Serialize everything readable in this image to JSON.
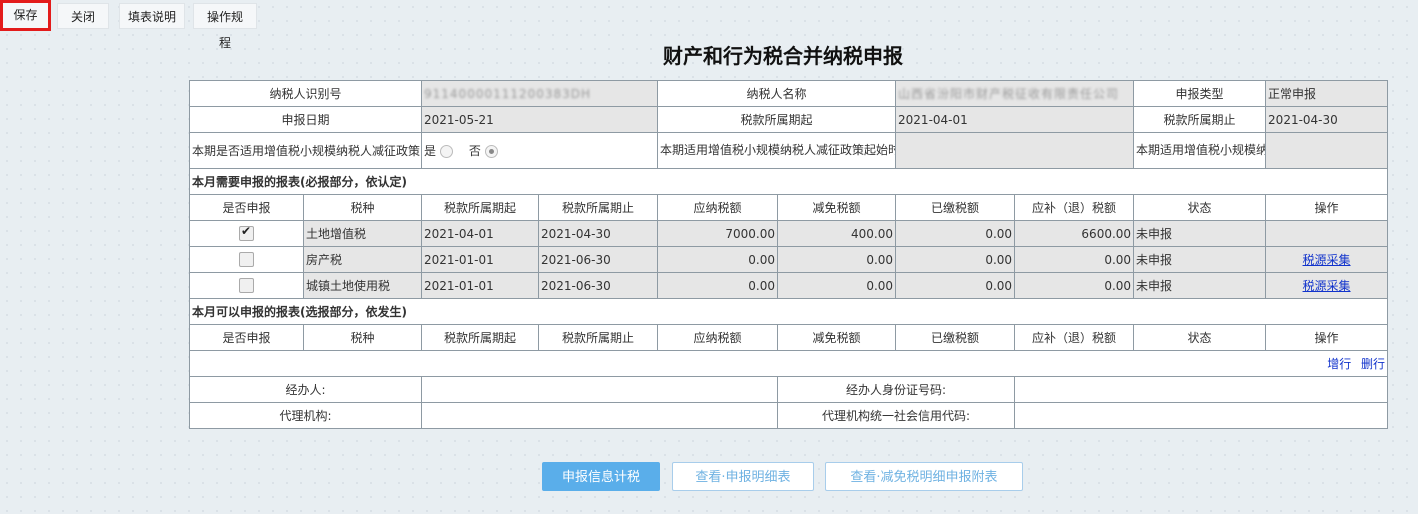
{
  "toolbar": {
    "save": "保存",
    "close": "关闭",
    "fill_help": "填表说明",
    "operation_rules": "操作规程"
  },
  "title": "财产和行为税合并纳税申报",
  "info": {
    "taxpayer_id_label": "纳税人识别号",
    "taxpayer_id_value": "91140000111200383DH",
    "taxpayer_name_label": "纳税人名称",
    "taxpayer_name_value": "山西省汾阳市财产税征收有限责任公司",
    "declare_type_label": "申报类型",
    "declare_type_value": "正常申报",
    "declare_date_label": "申报日期",
    "declare_date_value": "2021-05-21",
    "period_start_label": "税款所属期起",
    "period_start_value": "2021-04-01",
    "period_end_label": "税款所属期止",
    "period_end_value": "2021-04-30",
    "small_policy_label": "本期是否适用增值税小规模纳税人减征政策",
    "yes_label": "是",
    "no_label": "否",
    "policy_start_label": "本期适用增值税小规模纳税人减征政策起始时间",
    "policy_end_label": "本期适用增值税小规模纳税人减征政策终止时间"
  },
  "required_section": "本月需要申报的报表(必报部分，依认定)",
  "optional_section": "本月可以申报的报表(选报部分，依发生)",
  "columns": [
    "是否申报",
    "税种",
    "税款所属期起",
    "税款所属期止",
    "应纳税额",
    "减免税额",
    "已缴税额",
    "应补（退）税额",
    "状态",
    "操作"
  ],
  "rows": [
    {
      "checked": true,
      "tax": "土地增值税",
      "start": "2021-04-01",
      "end": "2021-04-30",
      "payable": "7000.00",
      "relief": "400.00",
      "paid": "0.00",
      "due": "6600.00",
      "status": "未申报",
      "action": ""
    },
    {
      "checked": false,
      "tax": "房产税",
      "start": "2021-01-01",
      "end": "2021-06-30",
      "payable": "0.00",
      "relief": "0.00",
      "paid": "0.00",
      "due": "0.00",
      "status": "未申报",
      "action": "税源采集"
    },
    {
      "checked": false,
      "tax": "城镇土地使用税",
      "start": "2021-01-01",
      "end": "2021-06-30",
      "payable": "0.00",
      "relief": "0.00",
      "paid": "0.00",
      "due": "0.00",
      "status": "未申报",
      "action": "税源采集"
    }
  ],
  "row_ops": {
    "add": "增行",
    "delete": "删行"
  },
  "agent": {
    "handler_label": "经办人:",
    "handler_id_label": "经办人身份证号码:",
    "agency_label": "代理机构:",
    "agency_code_label": "代理机构统一社会信用代码:"
  },
  "bottom": {
    "calc": "申报信息计税",
    "view_detail": "查看·申报明细表",
    "view_relief": "查看·减免税明细申报附表"
  }
}
